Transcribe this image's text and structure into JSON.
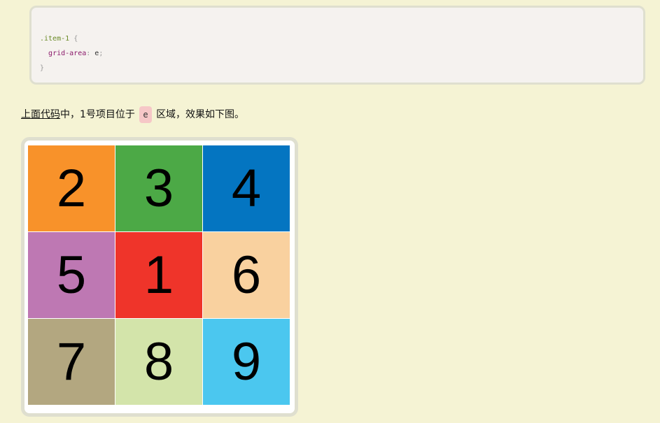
{
  "code": {
    "selector": ".item-1",
    "open_brace": "{",
    "property": "grid-area",
    "colon": ":",
    "value": "e",
    "semicolon": ";",
    "close_brace": "}"
  },
  "paragraph": {
    "link_text": "上面代码",
    "text_before_code": "中，1号项目位于",
    "inline_code": "e",
    "text_after_code": "区域，效果如下图。"
  },
  "grid": {
    "cells": [
      {
        "label": "2",
        "color": "#f8922a"
      },
      {
        "label": "3",
        "color": "#4ca946"
      },
      {
        "label": "4",
        "color": "#0475c1"
      },
      {
        "label": "5",
        "color": "#be78b3"
      },
      {
        "label": "1",
        "color": "#ef342a"
      },
      {
        "label": "6",
        "color": "#f9d19f"
      },
      {
        "label": "7",
        "color": "#b3a780"
      },
      {
        "label": "8",
        "color": "#d3e4aa"
      },
      {
        "label": "9",
        "color": "#4bc7ef"
      }
    ]
  }
}
